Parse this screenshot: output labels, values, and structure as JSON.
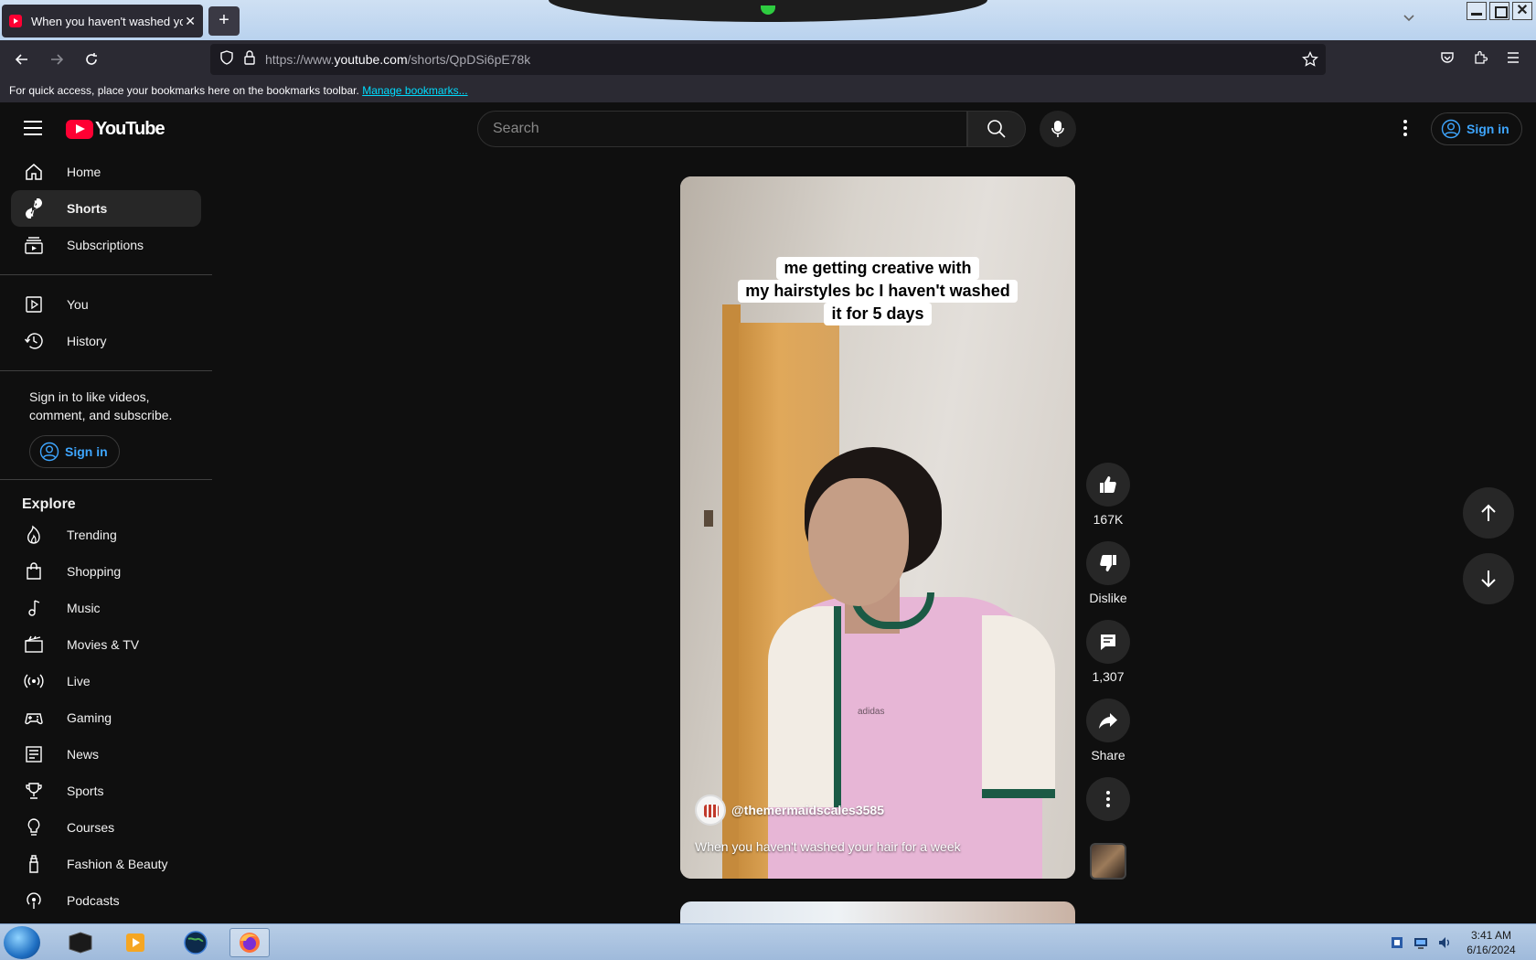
{
  "browser": {
    "tab_title": "When you haven't washed your hair for a week - YouTube",
    "tab_close": "✕",
    "new_tab": "+",
    "url_prefix": "https://www.",
    "url_domain": "youtube.com",
    "url_path": "/shorts/QpDSi6pE78k",
    "bookmarks_msg": "For quick access, place your bookmarks here on the bookmarks toolbar.",
    "bookmarks_link": "Manage bookmarks...",
    "notch_color": "#2ecc40"
  },
  "youtube": {
    "logo_text": "YouTube",
    "search_placeholder": "Search",
    "signin_label": "Sign in",
    "brand_color": "#ff0033",
    "link_color": "#3ea6ff"
  },
  "sidebar": {
    "main": [
      {
        "label": "Home",
        "icon": "home-icon"
      },
      {
        "label": "Shorts",
        "icon": "shorts-icon",
        "active": true
      },
      {
        "label": "Subscriptions",
        "icon": "subscriptions-icon"
      }
    ],
    "you": [
      {
        "label": "You",
        "icon": "you-icon"
      },
      {
        "label": "History",
        "icon": "history-icon"
      }
    ],
    "signin_message": "Sign in to like videos, comment, and subscribe.",
    "signin_button": "Sign in",
    "explore_title": "Explore",
    "explore": [
      {
        "label": "Trending",
        "icon": "trending-icon"
      },
      {
        "label": "Shopping",
        "icon": "shopping-icon"
      },
      {
        "label": "Music",
        "icon": "music-icon"
      },
      {
        "label": "Movies & TV",
        "icon": "movies-icon"
      },
      {
        "label": "Live",
        "icon": "live-icon"
      },
      {
        "label": "Gaming",
        "icon": "gaming-icon"
      },
      {
        "label": "News",
        "icon": "news-icon"
      },
      {
        "label": "Sports",
        "icon": "sports-icon"
      },
      {
        "label": "Courses",
        "icon": "courses-icon"
      },
      {
        "label": "Fashion & Beauty",
        "icon": "fashion-icon"
      },
      {
        "label": "Podcasts",
        "icon": "podcasts-icon"
      }
    ]
  },
  "short": {
    "caption_lines": [
      "me getting creative with",
      "my hairstyles bc I haven't washed",
      "it for 5 days"
    ],
    "shirt_brand": "adidas",
    "channel_handle": "@themermaidscales3585",
    "title": "When you haven't washed your hair for a week"
  },
  "actions": {
    "likes": "167K",
    "dislike": "Dislike",
    "comments": "1,307",
    "share": "Share"
  },
  "taskbar": {
    "time": "3:41 AM",
    "date": "6/16/2024"
  }
}
